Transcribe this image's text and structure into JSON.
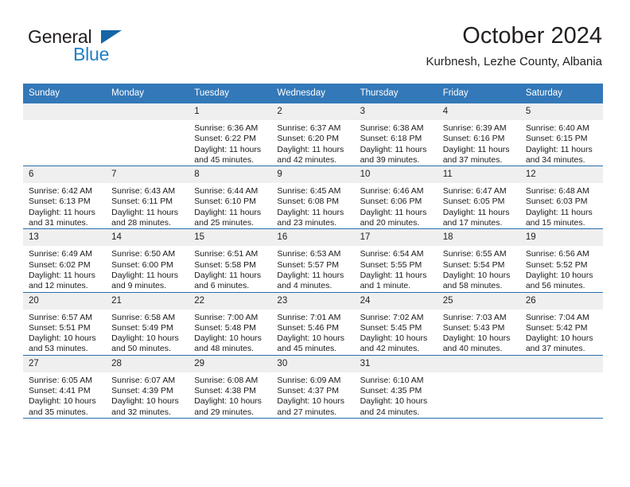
{
  "brand": {
    "name_top": "General",
    "name_bottom": "Blue",
    "triangle_color": "#1565a6",
    "blue_color": "#1f7fc4"
  },
  "header": {
    "title": "October 2024",
    "subtitle": "Kurbnesh, Lezhe County, Albania"
  },
  "theme": {
    "header_bg": "#3378b8",
    "week_divider": "#2a6ead",
    "daynum_bg": "#efefef"
  },
  "weekday_headers": [
    "Sunday",
    "Monday",
    "Tuesday",
    "Wednesday",
    "Thursday",
    "Friday",
    "Saturday"
  ],
  "labels": {
    "sunrise_prefix": "Sunrise:",
    "sunset_prefix": "Sunset:",
    "daylight_prefix": "Daylight:"
  },
  "weeks": [
    [
      {
        "day": "",
        "sunrise": "",
        "sunset": "",
        "daylight": "",
        "empty": true
      },
      {
        "day": "",
        "sunrise": "",
        "sunset": "",
        "daylight": "",
        "empty": true
      },
      {
        "day": "1",
        "sunrise": "Sunrise: 6:36 AM",
        "sunset": "Sunset: 6:22 PM",
        "daylight": "Daylight: 11 hours and 45 minutes."
      },
      {
        "day": "2",
        "sunrise": "Sunrise: 6:37 AM",
        "sunset": "Sunset: 6:20 PM",
        "daylight": "Daylight: 11 hours and 42 minutes."
      },
      {
        "day": "3",
        "sunrise": "Sunrise: 6:38 AM",
        "sunset": "Sunset: 6:18 PM",
        "daylight": "Daylight: 11 hours and 39 minutes."
      },
      {
        "day": "4",
        "sunrise": "Sunrise: 6:39 AM",
        "sunset": "Sunset: 6:16 PM",
        "daylight": "Daylight: 11 hours and 37 minutes."
      },
      {
        "day": "5",
        "sunrise": "Sunrise: 6:40 AM",
        "sunset": "Sunset: 6:15 PM",
        "daylight": "Daylight: 11 hours and 34 minutes."
      }
    ],
    [
      {
        "day": "6",
        "sunrise": "Sunrise: 6:42 AM",
        "sunset": "Sunset: 6:13 PM",
        "daylight": "Daylight: 11 hours and 31 minutes."
      },
      {
        "day": "7",
        "sunrise": "Sunrise: 6:43 AM",
        "sunset": "Sunset: 6:11 PM",
        "daylight": "Daylight: 11 hours and 28 minutes."
      },
      {
        "day": "8",
        "sunrise": "Sunrise: 6:44 AM",
        "sunset": "Sunset: 6:10 PM",
        "daylight": "Daylight: 11 hours and 25 minutes."
      },
      {
        "day": "9",
        "sunrise": "Sunrise: 6:45 AM",
        "sunset": "Sunset: 6:08 PM",
        "daylight": "Daylight: 11 hours and 23 minutes."
      },
      {
        "day": "10",
        "sunrise": "Sunrise: 6:46 AM",
        "sunset": "Sunset: 6:06 PM",
        "daylight": "Daylight: 11 hours and 20 minutes."
      },
      {
        "day": "11",
        "sunrise": "Sunrise: 6:47 AM",
        "sunset": "Sunset: 6:05 PM",
        "daylight": "Daylight: 11 hours and 17 minutes."
      },
      {
        "day": "12",
        "sunrise": "Sunrise: 6:48 AM",
        "sunset": "Sunset: 6:03 PM",
        "daylight": "Daylight: 11 hours and 15 minutes."
      }
    ],
    [
      {
        "day": "13",
        "sunrise": "Sunrise: 6:49 AM",
        "sunset": "Sunset: 6:02 PM",
        "daylight": "Daylight: 11 hours and 12 minutes."
      },
      {
        "day": "14",
        "sunrise": "Sunrise: 6:50 AM",
        "sunset": "Sunset: 6:00 PM",
        "daylight": "Daylight: 11 hours and 9 minutes."
      },
      {
        "day": "15",
        "sunrise": "Sunrise: 6:51 AM",
        "sunset": "Sunset: 5:58 PM",
        "daylight": "Daylight: 11 hours and 6 minutes."
      },
      {
        "day": "16",
        "sunrise": "Sunrise: 6:53 AM",
        "sunset": "Sunset: 5:57 PM",
        "daylight": "Daylight: 11 hours and 4 minutes."
      },
      {
        "day": "17",
        "sunrise": "Sunrise: 6:54 AM",
        "sunset": "Sunset: 5:55 PM",
        "daylight": "Daylight: 11 hours and 1 minute."
      },
      {
        "day": "18",
        "sunrise": "Sunrise: 6:55 AM",
        "sunset": "Sunset: 5:54 PM",
        "daylight": "Daylight: 10 hours and 58 minutes."
      },
      {
        "day": "19",
        "sunrise": "Sunrise: 6:56 AM",
        "sunset": "Sunset: 5:52 PM",
        "daylight": "Daylight: 10 hours and 56 minutes."
      }
    ],
    [
      {
        "day": "20",
        "sunrise": "Sunrise: 6:57 AM",
        "sunset": "Sunset: 5:51 PM",
        "daylight": "Daylight: 10 hours and 53 minutes."
      },
      {
        "day": "21",
        "sunrise": "Sunrise: 6:58 AM",
        "sunset": "Sunset: 5:49 PM",
        "daylight": "Daylight: 10 hours and 50 minutes."
      },
      {
        "day": "22",
        "sunrise": "Sunrise: 7:00 AM",
        "sunset": "Sunset: 5:48 PM",
        "daylight": "Daylight: 10 hours and 48 minutes."
      },
      {
        "day": "23",
        "sunrise": "Sunrise: 7:01 AM",
        "sunset": "Sunset: 5:46 PM",
        "daylight": "Daylight: 10 hours and 45 minutes."
      },
      {
        "day": "24",
        "sunrise": "Sunrise: 7:02 AM",
        "sunset": "Sunset: 5:45 PM",
        "daylight": "Daylight: 10 hours and 42 minutes."
      },
      {
        "day": "25",
        "sunrise": "Sunrise: 7:03 AM",
        "sunset": "Sunset: 5:43 PM",
        "daylight": "Daylight: 10 hours and 40 minutes."
      },
      {
        "day": "26",
        "sunrise": "Sunrise: 7:04 AM",
        "sunset": "Sunset: 5:42 PM",
        "daylight": "Daylight: 10 hours and 37 minutes."
      }
    ],
    [
      {
        "day": "27",
        "sunrise": "Sunrise: 6:05 AM",
        "sunset": "Sunset: 4:41 PM",
        "daylight": "Daylight: 10 hours and 35 minutes."
      },
      {
        "day": "28",
        "sunrise": "Sunrise: 6:07 AM",
        "sunset": "Sunset: 4:39 PM",
        "daylight": "Daylight: 10 hours and 32 minutes."
      },
      {
        "day": "29",
        "sunrise": "Sunrise: 6:08 AM",
        "sunset": "Sunset: 4:38 PM",
        "daylight": "Daylight: 10 hours and 29 minutes."
      },
      {
        "day": "30",
        "sunrise": "Sunrise: 6:09 AM",
        "sunset": "Sunset: 4:37 PM",
        "daylight": "Daylight: 10 hours and 27 minutes."
      },
      {
        "day": "31",
        "sunrise": "Sunrise: 6:10 AM",
        "sunset": "Sunset: 4:35 PM",
        "daylight": "Daylight: 10 hours and 24 minutes."
      },
      {
        "day": "",
        "sunrise": "",
        "sunset": "",
        "daylight": "",
        "empty": true
      },
      {
        "day": "",
        "sunrise": "",
        "sunset": "",
        "daylight": "",
        "empty": true
      }
    ]
  ]
}
